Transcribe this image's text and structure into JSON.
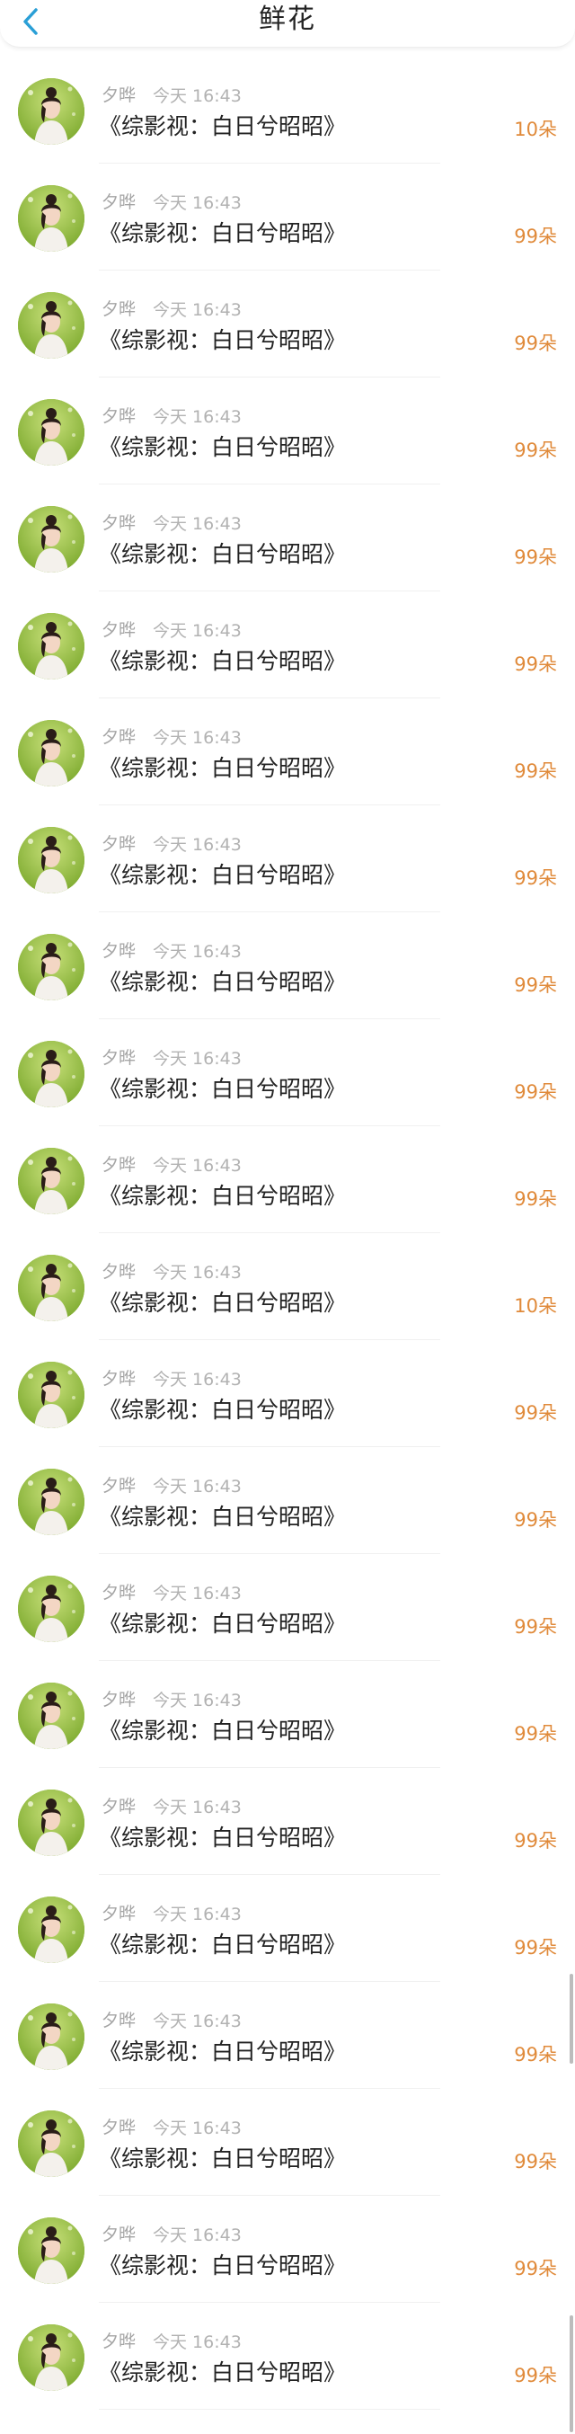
{
  "header": {
    "title": "鲜花",
    "back_icon": "chevron-left-icon",
    "accent_color": "#2a9fd6"
  },
  "records": [
    {
      "name": "夕晔",
      "time": "今天 16:43",
      "book": "《综影视：白日兮昭昭》",
      "count": "10朵"
    },
    {
      "name": "夕晔",
      "time": "今天 16:43",
      "book": "《综影视：白日兮昭昭》",
      "count": "99朵"
    },
    {
      "name": "夕晔",
      "time": "今天 16:43",
      "book": "《综影视：白日兮昭昭》",
      "count": "99朵"
    },
    {
      "name": "夕晔",
      "time": "今天 16:43",
      "book": "《综影视：白日兮昭昭》",
      "count": "99朵"
    },
    {
      "name": "夕晔",
      "time": "今天 16:43",
      "book": "《综影视：白日兮昭昭》",
      "count": "99朵"
    },
    {
      "name": "夕晔",
      "time": "今天 16:43",
      "book": "《综影视：白日兮昭昭》",
      "count": "99朵"
    },
    {
      "name": "夕晔",
      "time": "今天 16:43",
      "book": "《综影视：白日兮昭昭》",
      "count": "99朵"
    },
    {
      "name": "夕晔",
      "time": "今天 16:43",
      "book": "《综影视：白日兮昭昭》",
      "count": "99朵"
    },
    {
      "name": "夕晔",
      "time": "今天 16:43",
      "book": "《综影视：白日兮昭昭》",
      "count": "99朵"
    },
    {
      "name": "夕晔",
      "time": "今天 16:43",
      "book": "《综影视：白日兮昭昭》",
      "count": "99朵"
    },
    {
      "name": "夕晔",
      "time": "今天 16:43",
      "book": "《综影视：白日兮昭昭》",
      "count": "99朵"
    },
    {
      "name": "夕晔",
      "time": "今天 16:43",
      "book": "《综影视：白日兮昭昭》",
      "count": "10朵"
    },
    {
      "name": "夕晔",
      "time": "今天 16:43",
      "book": "《综影视：白日兮昭昭》",
      "count": "99朵"
    },
    {
      "name": "夕晔",
      "time": "今天 16:43",
      "book": "《综影视：白日兮昭昭》",
      "count": "99朵"
    },
    {
      "name": "夕晔",
      "time": "今天 16:43",
      "book": "《综影视：白日兮昭昭》",
      "count": "99朵"
    },
    {
      "name": "夕晔",
      "time": "今天 16:43",
      "book": "《综影视：白日兮昭昭》",
      "count": "99朵"
    },
    {
      "name": "夕晔",
      "time": "今天 16:43",
      "book": "《综影视：白日兮昭昭》",
      "count": "99朵"
    },
    {
      "name": "夕晔",
      "time": "今天 16:43",
      "book": "《综影视：白日兮昭昭》",
      "count": "99朵"
    },
    {
      "name": "夕晔",
      "time": "今天 16:43",
      "book": "《综影视：白日兮昭昭》",
      "count": "99朵"
    },
    {
      "name": "夕晔",
      "time": "今天 16:43",
      "book": "《综影视：白日兮昭昭》",
      "count": "99朵"
    },
    {
      "name": "夕晔",
      "time": "今天 16:43",
      "book": "《综影视：白日兮昭昭》",
      "count": "99朵"
    },
    {
      "name": "夕晔",
      "time": "今天 16:43",
      "book": "《综影视：白日兮昭昭》",
      "count": "99朵"
    }
  ],
  "colors": {
    "count_color": "#e08a3a",
    "name_color": "#a5a5a5",
    "text_color": "#222222"
  }
}
